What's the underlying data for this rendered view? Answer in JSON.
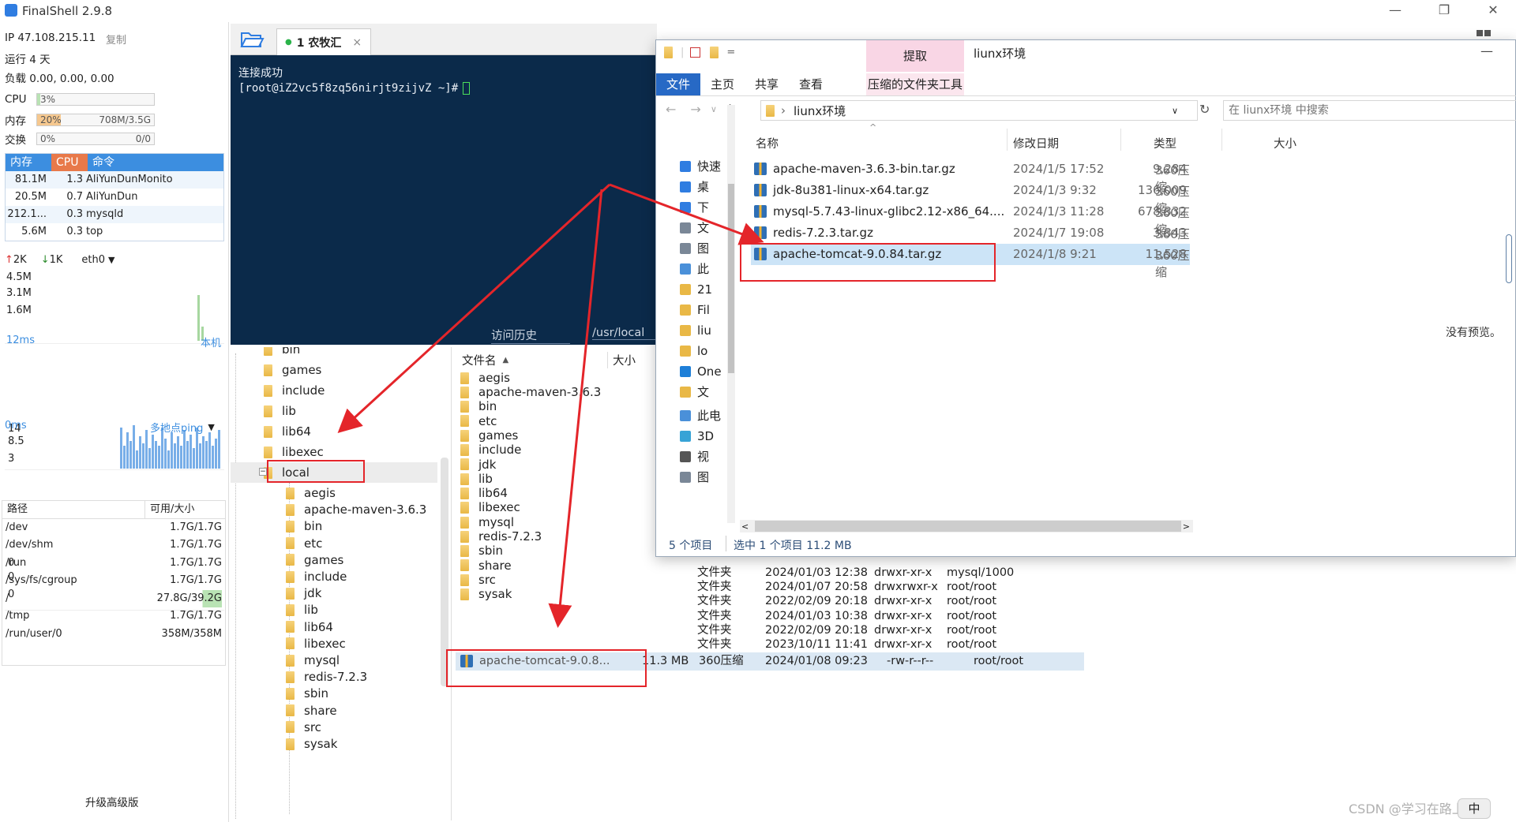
{
  "app": {
    "title": "FinalShell 2.9.8"
  },
  "window_controls": [
    "—",
    "❐",
    "✕"
  ],
  "stats": {
    "ip_label": "IP 47.108.215.11",
    "copy_label": "复制",
    "uptime": "运行 4 天",
    "load": "负载 0.00, 0.00, 0.00",
    "cpu_label": "CPU",
    "cpu_value": "3%",
    "cpu_fraction": 0.03,
    "mem_label": "内存",
    "mem_value": "20%",
    "mem_detail": "708M/3.5G",
    "mem_fraction": 0.2,
    "swap_label": "交换",
    "swap_value": "0%",
    "swap_detail": "0/0",
    "swap_fraction": 0.0
  },
  "processes": {
    "headers": [
      "内存",
      "CPU",
      "命令"
    ],
    "rows": [
      {
        "mem": "81.1M",
        "cpu": "1.3",
        "cmd": "AliYunDunMonito"
      },
      {
        "mem": "20.5M",
        "cpu": "0.7",
        "cmd": "AliYunDun"
      },
      {
        "mem": "212.1...",
        "cpu": "0.3",
        "cmd": "mysqld"
      },
      {
        "mem": "5.6M",
        "cpu": "0.3",
        "cmd": "top"
      }
    ]
  },
  "network": {
    "up": "2K",
    "down": "1K",
    "iface": "eth0",
    "levels": [
      "4.5M",
      "3.1M",
      "1.6M"
    ],
    "latency": "12ms",
    "latency_target": "本机",
    "latency_levels": [
      "14",
      "8.5",
      "3"
    ],
    "ping_ms": "0ms",
    "ping_label": "多地点ping",
    "ping_levels": [
      "0",
      "0",
      "0"
    ]
  },
  "disks": {
    "headers": [
      "路径",
      "可用/大小"
    ],
    "rows": [
      {
        "path": "/dev",
        "size": "1.7G/1.7G"
      },
      {
        "path": "/dev/shm",
        "size": "1.7G/1.7G"
      },
      {
        "path": "/run",
        "size": "1.7G/1.7G"
      },
      {
        "path": "/sys/fs/cgroup",
        "size": "1.7G/1.7G"
      },
      {
        "path": "/",
        "size": "27.8G/39.2G"
      },
      {
        "path": "/tmp",
        "size": "1.7G/1.7G"
      },
      {
        "path": "/run/user/0",
        "size": "358M/358M"
      }
    ]
  },
  "upgrade_label": "升级高级版",
  "tabs": {
    "session_tab": "1 农牧汇",
    "close": "×"
  },
  "terminal": {
    "line1": "连接成功",
    "prompt": "[root@iZ2vc5f8zq56nirjt9zijvZ ~]#",
    "history_label": "访问历史",
    "path_label": "/usr/local"
  },
  "tree": {
    "top_items": [
      "bin",
      "games",
      "include",
      "lib",
      "lib64",
      "libexec",
      "local"
    ],
    "local_children": [
      "aegis",
      "apache-maven-3.6.3",
      "bin",
      "etc",
      "games",
      "include",
      "jdk",
      "lib",
      "lib64",
      "libexec",
      "mysql",
      "redis-7.2.3",
      "sbin",
      "share",
      "src",
      "sysak"
    ]
  },
  "remote": {
    "headers": {
      "name": "文件名",
      "size": "大小"
    },
    "names": [
      "aegis",
      "apache-maven-3.6.3",
      "bin",
      "etc",
      "games",
      "include",
      "jdk",
      "lib",
      "lib64",
      "libexec",
      "mysql",
      "redis-7.2.3",
      "sbin",
      "share",
      "src",
      "sysak"
    ],
    "detail_rows": [
      {
        "name": "mysql",
        "type": "文件夹",
        "date": "2024/01/03 12:38",
        "perm": "drwxr-xr-x",
        "owner": "mysql/1000"
      },
      {
        "name": "redis-7.2.3",
        "type": "文件夹",
        "date": "2024/01/07 20:58",
        "perm": "drwxrwxr-x",
        "owner": "root/root"
      },
      {
        "name": "sbin",
        "type": "文件夹",
        "date": "2022/02/09 20:18",
        "perm": "drwxr-xr-x",
        "owner": "root/root"
      },
      {
        "name": "share",
        "type": "文件夹",
        "date": "2024/01/03 10:38",
        "perm": "drwxr-xr-x",
        "owner": "root/root"
      },
      {
        "name": "src",
        "type": "文件夹",
        "date": "2022/02/09 20:18",
        "perm": "drwxr-xr-x",
        "owner": "root/root"
      },
      {
        "name": "sysak",
        "type": "文件夹",
        "date": "2023/10/11 11:41",
        "perm": "drwxr-xr-x",
        "owner": "root/root"
      }
    ],
    "uploaded": {
      "name": "apache-tomcat-9.0.8...",
      "size": "11.3 MB",
      "type": "360压缩",
      "date": "2024/01/08 09:23",
      "perm": "-rw-r--r--",
      "owner": "root/root"
    }
  },
  "explorer": {
    "qat_separator": "=",
    "contextual_tab": "提取",
    "folder_title": "liunx环境",
    "tabs": [
      "文件",
      "主页",
      "共享",
      "查看"
    ],
    "tools_tab": "压缩的文件夹工具",
    "address": "liunx环境",
    "search_placeholder": "在 liunx环境 中搜索",
    "columns": {
      "name": "名称",
      "date": "修改日期",
      "type": "类型",
      "size": "大小"
    },
    "nav": [
      "快速",
      "桌",
      "下",
      "文",
      "图",
      "此",
      "21",
      "Fil",
      "liu",
      "lo",
      "One",
      "文",
      "此电",
      "3D",
      "视",
      "图"
    ],
    "files": [
      {
        "name": "apache-maven-3.6.3-bin.tar.gz",
        "date": "2024/1/5 17:52",
        "type": "360压缩",
        "size": "9,284"
      },
      {
        "name": "jdk-8u381-linux-x64.tar.gz",
        "date": "2024/1/3 9:32",
        "type": "360压缩",
        "size": "136,009"
      },
      {
        "name": "mysql-5.7.43-linux-glibc2.12-x86_64....",
        "date": "2024/1/3 11:28",
        "type": "360压缩",
        "size": "678,332"
      },
      {
        "name": "redis-7.2.3.tar.gz",
        "date": "2024/1/7 19:08",
        "type": "360压缩",
        "size": "3,343"
      },
      {
        "name": "apache-tomcat-9.0.84.tar.gz",
        "date": "2024/1/8 9:21",
        "type": "360压缩",
        "size": "11,528"
      }
    ],
    "no_preview": "没有预览。",
    "status_count": "5 个项目",
    "status_selected": "选中 1 个项目  11.2 MB"
  },
  "watermark": "CSDN @学习在路上ing",
  "ime": "中",
  "colors": {
    "accent": "#3c8ee0",
    "terminal_bg": "#0b2a4a",
    "highlight": "#e4252a",
    "selection": "#cce4f7",
    "chart_bar": "#78aee8"
  }
}
